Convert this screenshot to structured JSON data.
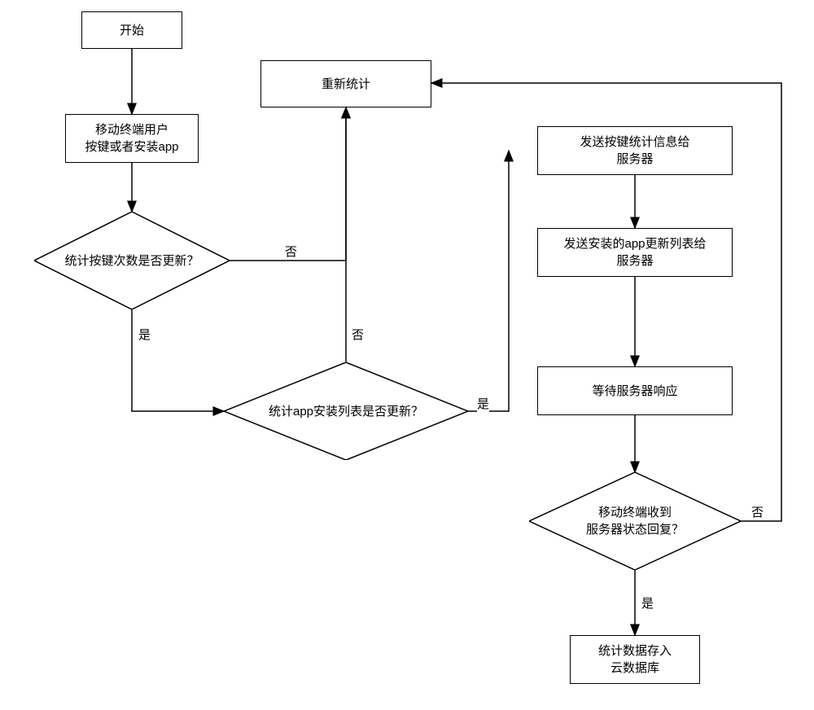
{
  "chart_data": {
    "type": "flowchart",
    "nodes": [
      {
        "id": "start",
        "shape": "rect",
        "label": "开始"
      },
      {
        "id": "input",
        "shape": "rect",
        "label": "移动终端用户\n按键或者安装app"
      },
      {
        "id": "d1",
        "shape": "diamond",
        "label": "统计按键次数是否更新？"
      },
      {
        "id": "restat",
        "shape": "rect",
        "label": "重新统计"
      },
      {
        "id": "d2",
        "shape": "diamond",
        "label": "统计app安装列表是否更新？"
      },
      {
        "id": "sendKey",
        "shape": "rect",
        "label": "发送按键统计信息给\n服务器"
      },
      {
        "id": "sendApp",
        "shape": "rect",
        "label": "发送安装的app更新列表给\n服务器"
      },
      {
        "id": "wait",
        "shape": "rect",
        "label": "等待服务器响应"
      },
      {
        "id": "d3",
        "shape": "diamond",
        "label": "移动终端收到\n服务器状态回复？"
      },
      {
        "id": "store",
        "shape": "rect",
        "label": "统计数据存入\n云数据库"
      }
    ],
    "edges": [
      {
        "from": "start",
        "to": "input"
      },
      {
        "from": "input",
        "to": "d1"
      },
      {
        "from": "d1",
        "to": "restat",
        "label": "否"
      },
      {
        "from": "d1",
        "to": "d2",
        "label": "是"
      },
      {
        "from": "d2",
        "to": "restat",
        "label": "否"
      },
      {
        "from": "d2",
        "to": "sendKey",
        "label": "是"
      },
      {
        "from": "sendKey",
        "to": "sendApp"
      },
      {
        "from": "sendApp",
        "to": "wait"
      },
      {
        "from": "wait",
        "to": "d3"
      },
      {
        "from": "d3",
        "to": "restat",
        "label": "否"
      },
      {
        "from": "d3",
        "to": "store",
        "label": "是"
      }
    ]
  },
  "labels": {
    "start": "开始",
    "input_l1": "移动终端用户",
    "input_l2": "按键或者安装app",
    "d1": "统计按键次数是否更新？",
    "restat": "重新统计",
    "d2": "统计app安装列表是否更新？",
    "sendKey_l1": "发送按键统计信息给",
    "sendKey_l2": "服务器",
    "sendApp_l1": "发送安装的app更新列表给",
    "sendApp_l2": "服务器",
    "wait": "等待服务器响应",
    "d3_l1": "移动终端收到",
    "d3_l2": "服务器状态回复？",
    "store_l1": "统计数据存入",
    "store_l2": "云数据库",
    "yes": "是",
    "no": "否"
  }
}
